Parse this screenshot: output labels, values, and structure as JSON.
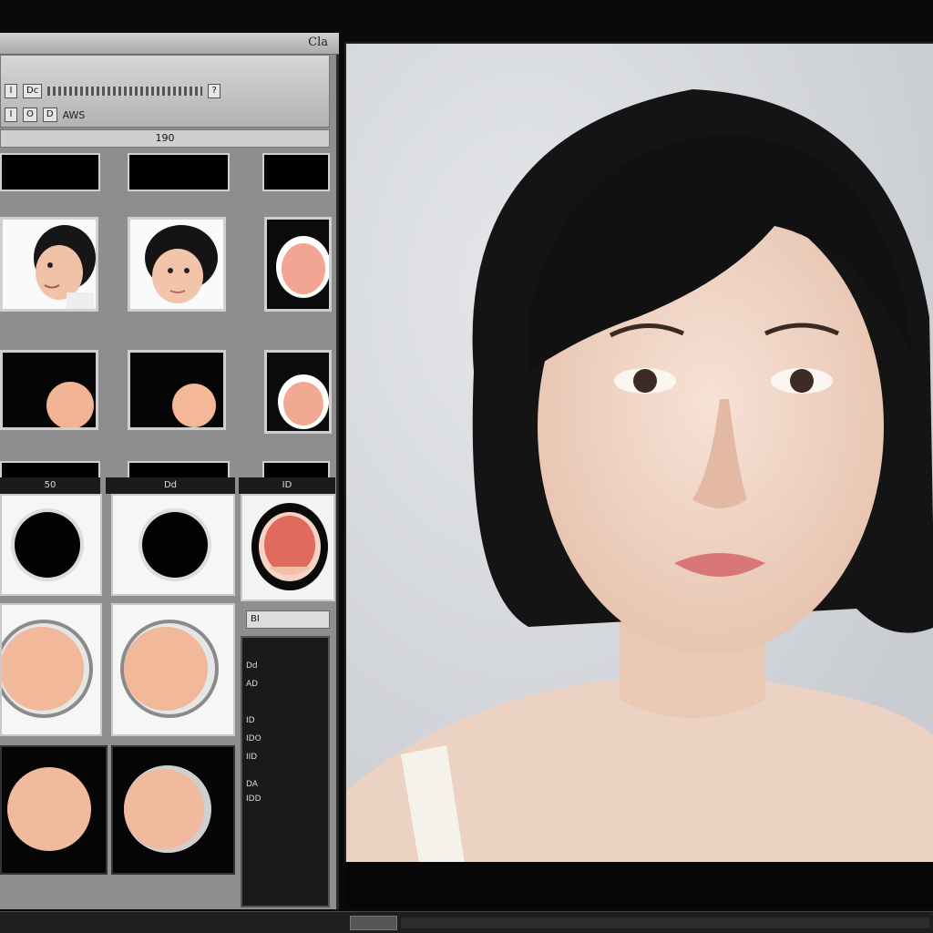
{
  "window": {
    "title": "Cla"
  },
  "toolbar": {
    "row1": [
      "I",
      "Dc",
      "?"
    ],
    "row2": [
      "I",
      "O",
      "D"
    ],
    "row2_label": "AWS",
    "frame_number": "190"
  },
  "swatch_headers": [
    "50",
    "Dd",
    "ID"
  ],
  "side_label": "BI",
  "side_items": [
    "Dd",
    "AD",
    "ID",
    "IDO",
    "IID",
    "DA",
    "IDD"
  ],
  "colors": {
    "panel": "#8e8e8e",
    "skin": "#f2b89a",
    "lip": "#e0786a",
    "hair": "#141414",
    "viewer_bg": "#d7d9dd"
  },
  "icons": [
    "face-thumbnail-icon",
    "skin-swatch-icon",
    "color-ring-icon",
    "mouth-icon",
    "portrait-image"
  ]
}
